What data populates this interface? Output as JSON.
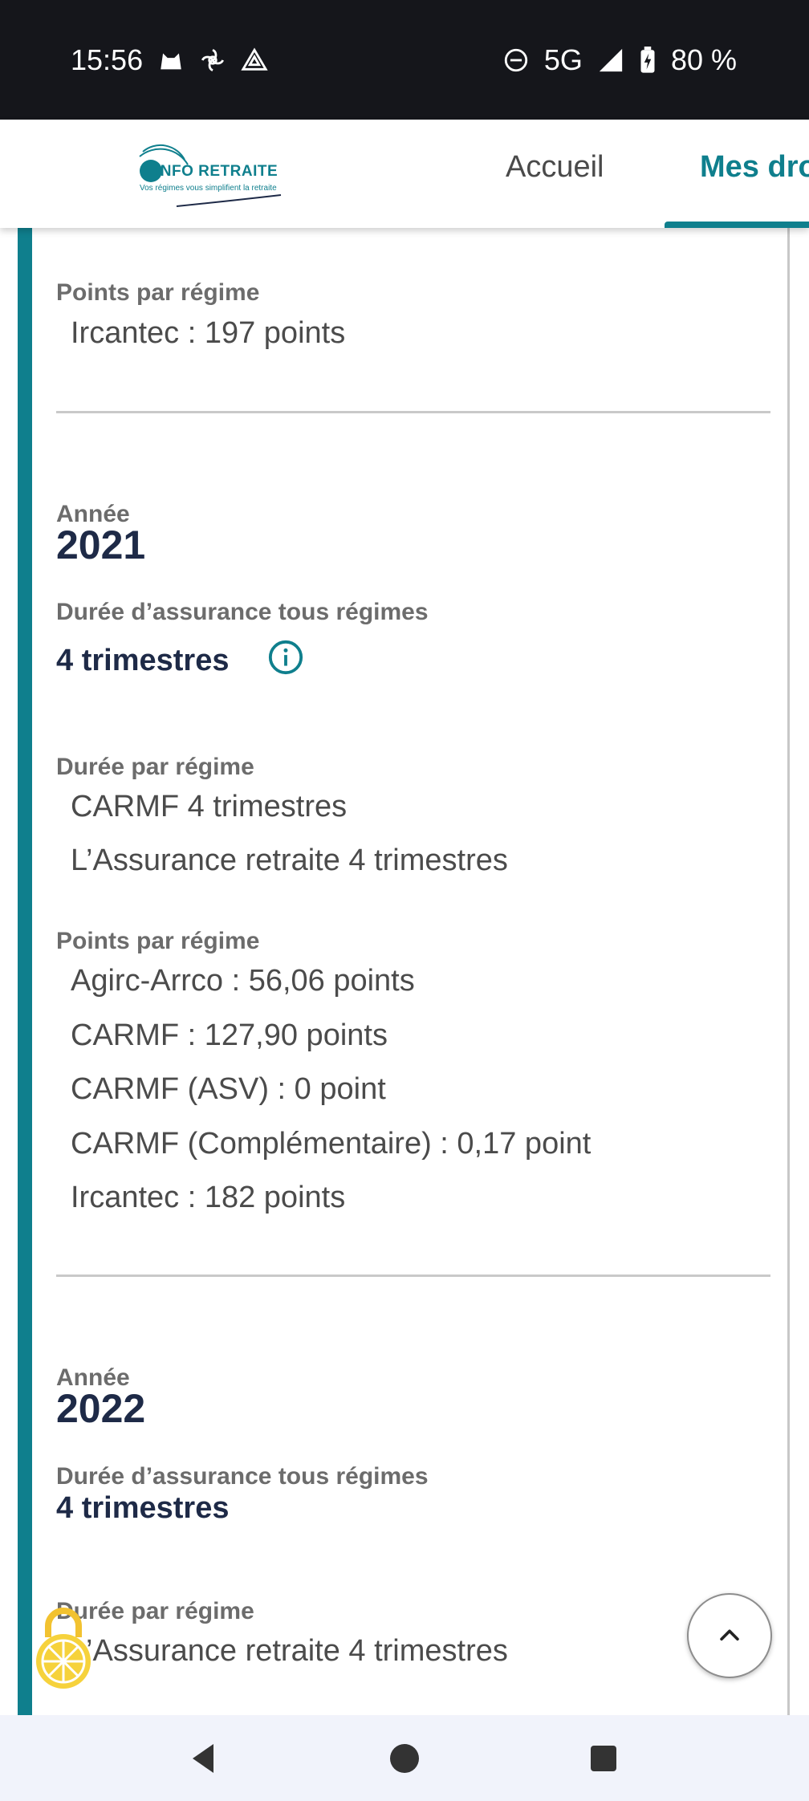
{
  "status_bar": {
    "time": "15:56",
    "network": "5G",
    "battery": "80 %",
    "icons_left": [
      "cat-notification-icon",
      "pinwheel-notification-icon",
      "drive-notification-icon"
    ],
    "icons_right": [
      "do-not-disturb-icon",
      "signal-icon",
      "battery-charging-icon"
    ]
  },
  "header": {
    "logo_text": "INFO RETRAITE",
    "logo_tagline": "Vos régimes vous simplifient la retraite",
    "nav": [
      {
        "label": "Accueil",
        "active": false
      },
      {
        "label": "Mes droits",
        "active": true
      }
    ]
  },
  "labels": {
    "year": "Année",
    "total_duration": "Durée d’assurance tous régimes",
    "duration_by_regime": "Durée par régime",
    "points_by_regime": "Points par régime"
  },
  "previous_section": {
    "points": [
      "Ircantec : 197 points"
    ]
  },
  "years": [
    {
      "year": "2021",
      "total_duration": "4 trimestres",
      "duration_by_regime": [
        "CARMF 4 trimestres",
        "L’Assurance retraite 4 trimestres"
      ],
      "points": [
        "Agirc-Arrco : 56,06 points",
        "CARMF : 127,90 points",
        "CARMF (ASV) : 0 point",
        "CARMF (Complémentaire) : 0,17 point",
        "Ircantec : 182 points"
      ]
    },
    {
      "year": "2022",
      "total_duration": "4 trimestres",
      "duration_by_regime": [
        "L’Assurance retraite 4 trimestres"
      ]
    }
  ],
  "colors": {
    "accent": "#0f7f8d",
    "heading": "#1e2a47",
    "status_bar": "#15161b"
  }
}
